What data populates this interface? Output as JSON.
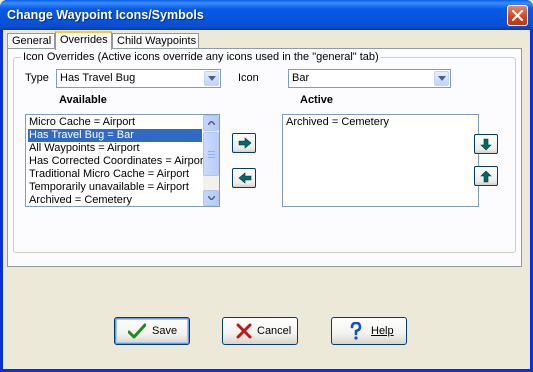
{
  "window": {
    "title": "Change Waypoint Icons/Symbols",
    "close_icon": "close-icon"
  },
  "tabs": [
    {
      "label": "General",
      "active": false
    },
    {
      "label": "Overrides",
      "active": true
    },
    {
      "label": "Child Waypoints",
      "active": false
    }
  ],
  "overrides": {
    "group_label": "Icon Overrides (Active icons override any icons used in the \"general\" tab)",
    "type_label": "Type",
    "type_value": "Has Travel Bug",
    "icon_label": "Icon",
    "icon_value": "Bar",
    "available_header": "Available",
    "active_header": "Active",
    "available_items": [
      "Micro Cache = Airport",
      "Has Travel Bug = Bar",
      "All Waypoints = Airport",
      "Has Corrected Coordinates = Airport",
      "Traditional Micro Cache = Airport",
      "Temporarily unavailable = Airport",
      "Archived = Cemetery"
    ],
    "available_selected_index": 1,
    "active_items": [
      "Archived = Cemetery"
    ],
    "move_right_icon": "arrow-right-icon",
    "move_left_icon": "arrow-left-icon",
    "move_down_icon": "arrow-down-icon",
    "move_up_icon": "arrow-up-icon"
  },
  "buttons": {
    "save": {
      "label": "Save",
      "icon": "checkmark-icon"
    },
    "cancel": {
      "label": "Cancel",
      "icon": "x-icon"
    },
    "help": {
      "label": "Help",
      "icon": "question-mark-icon"
    }
  },
  "colors": {
    "title_bar": "#0a5fe8",
    "selection": "#316ac5",
    "arrow_teal": "#006a6a",
    "save_green": "#1f8a1f",
    "cancel_red": "#c01818",
    "help_blue": "#1050c8"
  }
}
